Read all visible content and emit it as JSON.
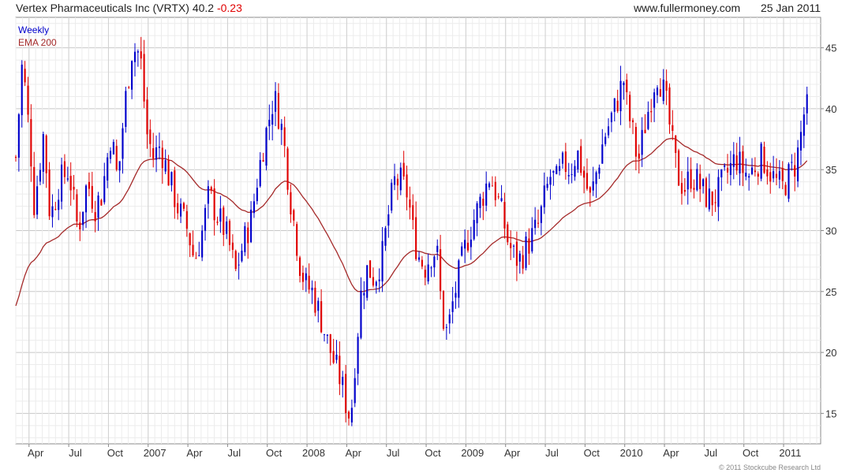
{
  "header": {
    "security": "Vertex Pharmaceuticals Inc (VRTX)",
    "last_price": "40.2",
    "change": "-0.23",
    "website": "www.fullermoney.com",
    "date": "25 Jan 2011"
  },
  "legend": {
    "weekly": "Weekly",
    "ema": "EMA 200"
  },
  "copyright": "© 2011 Stockcube Research Ltd",
  "colors": {
    "up": "#0000cc",
    "down": "#e00000",
    "ema": "#a52a2a",
    "grid": "#d8d8d8",
    "axis": "#888888"
  },
  "chart_data": {
    "type": "candlestick",
    "interval": "weekly",
    "grid": true,
    "legend_position": "top-left",
    "y_axis_side": "right",
    "ylim": [
      12.5,
      47.5
    ],
    "y_ticks": [
      15,
      20,
      25,
      30,
      35,
      40,
      45
    ],
    "x_ticks": [
      {
        "label": "Apr",
        "t": 1.5
      },
      {
        "label": "Jul",
        "t": 4.5
      },
      {
        "label": "Oct",
        "t": 7.5
      },
      {
        "label": "2007",
        "t": 10.5
      },
      {
        "label": "Apr",
        "t": 13.5
      },
      {
        "label": "Jul",
        "t": 16.5
      },
      {
        "label": "Oct",
        "t": 19.5
      },
      {
        "label": "2008",
        "t": 22.5
      },
      {
        "label": "Apr",
        "t": 25.5
      },
      {
        "label": "Jul",
        "t": 28.5
      },
      {
        "label": "Oct",
        "t": 31.5
      },
      {
        "label": "2009",
        "t": 34.5
      },
      {
        "label": "Apr",
        "t": 37.5
      },
      {
        "label": "Jul",
        "t": 40.5
      },
      {
        "label": "Oct",
        "t": 43.5
      },
      {
        "label": "2010",
        "t": 46.5
      },
      {
        "label": "Apr",
        "t": 49.5
      },
      {
        "label": "Jul",
        "t": 52.5
      },
      {
        "label": "Oct",
        "t": 55.5
      },
      {
        "label": "2011",
        "t": 58.5
      }
    ],
    "x_range_months": [
      0,
      60.8
    ],
    "price_path": [
      [
        0.0,
        36
      ],
      [
        0.5,
        44
      ],
      [
        1.1,
        37
      ],
      [
        1.4,
        32
      ],
      [
        2.1,
        38
      ],
      [
        2.6,
        31
      ],
      [
        3.3,
        34
      ],
      [
        4.0,
        35
      ],
      [
        4.7,
        30
      ],
      [
        5.4,
        34
      ],
      [
        6.0,
        32
      ],
      [
        6.5,
        33
      ],
      [
        7.2,
        38
      ],
      [
        7.7,
        34
      ],
      [
        8.2,
        40
      ],
      [
        8.8,
        45
      ],
      [
        9.4,
        44.5
      ],
      [
        9.9,
        38
      ],
      [
        10.4,
        36
      ],
      [
        10.9,
        37
      ],
      [
        11.4,
        35
      ],
      [
        12.2,
        32
      ],
      [
        13.0,
        30
      ],
      [
        13.5,
        27.5
      ],
      [
        14.1,
        30
      ],
      [
        14.6,
        33
      ],
      [
        15.1,
        31.5
      ],
      [
        15.8,
        30
      ],
      [
        16.2,
        28.5
      ],
      [
        16.6,
        26.5
      ],
      [
        17.2,
        29
      ],
      [
        17.8,
        31
      ],
      [
        18.2,
        34
      ],
      [
        18.7,
        37
      ],
      [
        19.1,
        39
      ],
      [
        19.5,
        41
      ],
      [
        20.0,
        39
      ],
      [
        20.4,
        36
      ],
      [
        20.7,
        33
      ],
      [
        21.1,
        30
      ],
      [
        21.5,
        27
      ],
      [
        21.9,
        25.5
      ],
      [
        22.4,
        25
      ],
      [
        23.0,
        23
      ],
      [
        23.5,
        21
      ],
      [
        24.1,
        19
      ],
      [
        24.6,
        17.5
      ],
      [
        25.0,
        15.5
      ],
      [
        25.3,
        14.5
      ],
      [
        25.6,
        19
      ],
      [
        26.1,
        25
      ],
      [
        26.6,
        27
      ],
      [
        27.1,
        26
      ],
      [
        27.7,
        28
      ],
      [
        28.1,
        31
      ],
      [
        28.6,
        34
      ],
      [
        29.1,
        34
      ],
      [
        29.6,
        33
      ],
      [
        30.0,
        30
      ],
      [
        30.4,
        28
      ],
      [
        30.9,
        27
      ],
      [
        31.3,
        28
      ],
      [
        31.8,
        28.5
      ],
      [
        32.2,
        23
      ],
      [
        32.6,
        21.5
      ],
      [
        33.0,
        24
      ],
      [
        33.4,
        26
      ],
      [
        33.8,
        28
      ],
      [
        34.3,
        30
      ],
      [
        34.8,
        31.5
      ],
      [
        35.3,
        33
      ],
      [
        35.8,
        34.5
      ],
      [
        36.3,
        33
      ],
      [
        36.8,
        31
      ],
      [
        37.2,
        29
      ],
      [
        37.6,
        28
      ],
      [
        38.0,
        27.5
      ],
      [
        38.5,
        28.5
      ],
      [
        39.0,
        29.5
      ],
      [
        39.5,
        30.5
      ],
      [
        39.9,
        32.5
      ],
      [
        40.4,
        34.5
      ],
      [
        40.9,
        34
      ],
      [
        41.4,
        35.5
      ],
      [
        41.9,
        35
      ],
      [
        42.4,
        36.5
      ],
      [
        42.9,
        34.5
      ],
      [
        43.4,
        32.5
      ],
      [
        43.9,
        35
      ],
      [
        44.4,
        37.5
      ],
      [
        44.9,
        39
      ],
      [
        45.4,
        40.5
      ],
      [
        45.9,
        42.5
      ],
      [
        46.2,
        40
      ],
      [
        46.6,
        38
      ],
      [
        47.0,
        35.5
      ],
      [
        47.5,
        38.5
      ],
      [
        48.0,
        41
      ],
      [
        48.4,
        43
      ],
      [
        48.8,
        42
      ],
      [
        49.2,
        40
      ],
      [
        49.6,
        37
      ],
      [
        50.0,
        34.5
      ],
      [
        50.5,
        33.5
      ],
      [
        51.0,
        34.5
      ],
      [
        51.5,
        34
      ],
      [
        52.0,
        33
      ],
      [
        52.5,
        32.5
      ],
      [
        53.0,
        33
      ],
      [
        53.4,
        34
      ],
      [
        53.9,
        35
      ],
      [
        54.4,
        36
      ],
      [
        54.9,
        35
      ],
      [
        55.4,
        34.5
      ],
      [
        55.9,
        35.5
      ],
      [
        56.4,
        36
      ],
      [
        56.9,
        35
      ],
      [
        57.4,
        34
      ],
      [
        57.9,
        33.5
      ],
      [
        58.4,
        34.5
      ],
      [
        58.9,
        35.5
      ],
      [
        59.2,
        37
      ],
      [
        59.5,
        39.5
      ],
      [
        59.9,
        40.2
      ]
    ]
  }
}
